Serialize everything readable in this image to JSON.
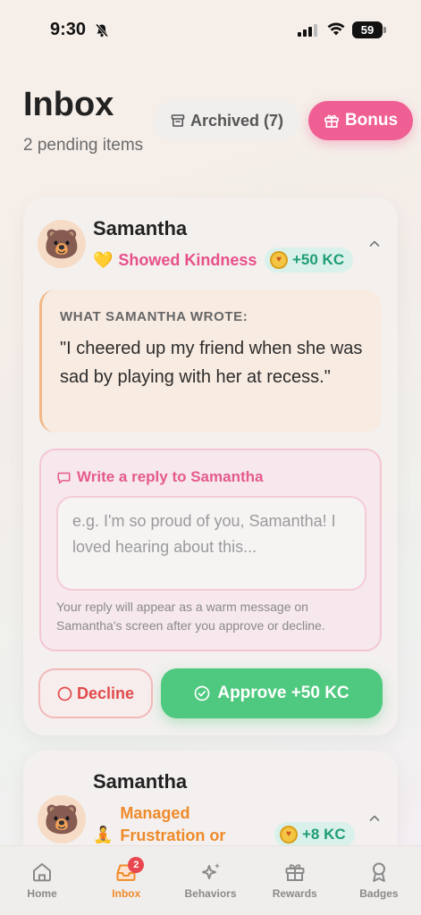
{
  "status_bar": {
    "time": "9:30",
    "battery": "59"
  },
  "header": {
    "title": "Inbox",
    "subtitle": "2 pending items",
    "archived_label": "Archived (7)",
    "bonus_label": "Bonus"
  },
  "cards": [
    {
      "child_name": "Samantha",
      "avatar_emoji": "🐻",
      "behavior_emoji": "💛",
      "behavior": "Showed Kindness",
      "reward": "+50 KC",
      "wrote_label": "WHAT SAMANTHA WROTE:",
      "wrote_text": "\"I cheered up my friend when she was sad by playing with her at recess.\"",
      "reply_title": "Write a reply to Samantha",
      "reply_placeholder": "e.g. I'm so proud of you, Samantha! I loved hearing about this...",
      "reply_value": "",
      "reply_hint": "Your reply will appear as a warm message on Samantha's screen after you approve or decline.",
      "decline_label": "Decline",
      "approve_label": "Approve +50 KC"
    },
    {
      "child_name": "Samantha",
      "avatar_emoji": "🐻",
      "behavior_emoji": "🧘",
      "behavior": "Managed Frustration or",
      "reward": "+8 KC"
    }
  ],
  "tabs": [
    {
      "label": "Home",
      "icon": "home-icon",
      "active": false
    },
    {
      "label": "Inbox",
      "icon": "inbox-icon",
      "active": true,
      "badge": "2"
    },
    {
      "label": "Behaviors",
      "icon": "sparkle-icon",
      "active": false
    },
    {
      "label": "Rewards",
      "icon": "gift-icon",
      "active": false
    },
    {
      "label": "Badges",
      "icon": "badge-icon",
      "active": false
    }
  ],
  "colors": {
    "accent_pink": "#ef5f93",
    "accent_orange": "#ef8a2a",
    "approve_green": "#4fc97f",
    "decline_red": "#e14b4b",
    "kc_teal": "#1f9d77"
  }
}
